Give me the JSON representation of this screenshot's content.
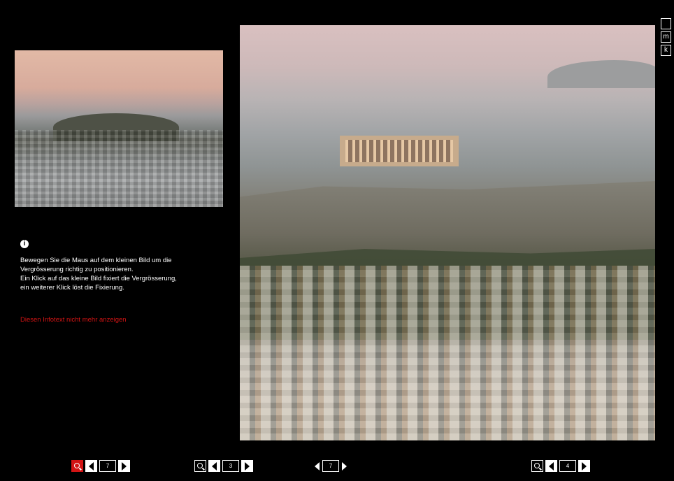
{
  "help": {
    "info_icon": "info-icon",
    "lines": [
      "Bewegen Sie die Maus auf dem kleinen Bild um die",
      "Vergrösserung richtig zu positionieren.",
      "Ein Klick auf das kleine Bild fixiert die Vergrösserung,",
      "ein weiterer Klick löst die Fixierung."
    ],
    "disable_link": "Diesen Infotext nicht mehr anzeigen"
  },
  "size_buttons": [
    "",
    "m",
    "k"
  ],
  "toolbar": {
    "group1_value": "7",
    "group2_value": "3",
    "center_value": "7",
    "group4_value": "4"
  },
  "colors": {
    "accent": "#d31414",
    "background": "#000000",
    "text": "#ffffff"
  }
}
